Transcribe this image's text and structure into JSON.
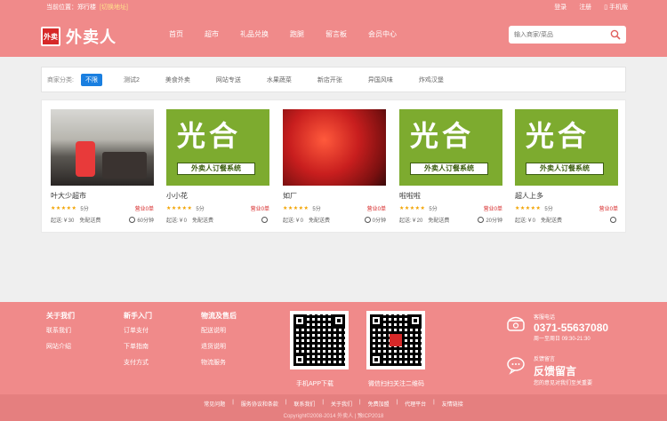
{
  "header": {
    "location_label": "当前位置：",
    "location_value": "郑行楼",
    "switch_label": "[切换地址]",
    "login": "登录",
    "register": "注册",
    "mobile": "手机版",
    "logo_badge": "外卖",
    "logo_text": "外卖人",
    "nav": [
      "首页",
      "超市",
      "礼品兑换",
      "跑腿",
      "留言板",
      "会员中心"
    ],
    "search_placeholder": "输入商家/菜品"
  },
  "filter": {
    "label": "商家分类:",
    "chips": [
      "不限",
      "测试2",
      "美食外卖",
      "网站专送",
      "水果蔬菜",
      "新店开张",
      "异国风味",
      "炸鸡汉堡"
    ],
    "active": "不限"
  },
  "shops": [
    {
      "name": "叶大少超市",
      "stars": "★★★★★",
      "score": "5分",
      "status": "营业0单",
      "min_order": "起送:￥30",
      "fee": "免配送费",
      "time": "60分钟",
      "image": "photo-delivery"
    },
    {
      "name": "小小花",
      "stars": "★★★★★",
      "score": "5分",
      "status": "营业0单",
      "min_order": "起送:￥0",
      "fee": "免配送费",
      "time": "",
      "image": "green-logo"
    },
    {
      "name": "如厂",
      "stars": "★★★★★",
      "score": "5分",
      "status": "营业0单",
      "min_order": "起送:￥0",
      "fee": "免配送费",
      "time": "0分钟",
      "image": "photo-leaves"
    },
    {
      "name": "啦啦啦",
      "stars": "★★★★★",
      "score": "5分",
      "status": "营业0单",
      "min_order": "起送:￥20",
      "fee": "免配送费",
      "time": "20分钟",
      "image": "green-logo"
    },
    {
      "name": "超人上多",
      "stars": "★★★★★",
      "score": "5分",
      "status": "营业0单",
      "min_order": "起送:￥0",
      "fee": "免配送费",
      "time": "",
      "image": "green-logo"
    }
  ],
  "logo_card": {
    "big": "光合",
    "bar": "外卖人订餐系统"
  },
  "footer": {
    "col1": {
      "title": "关于我们",
      "links": [
        "联系我们",
        "网站介绍"
      ]
    },
    "col2": {
      "title": "新手入门",
      "links": [
        "订单支付",
        "下单指南",
        "支付方式"
      ]
    },
    "col3": {
      "title": "物流及售后",
      "links": [
        "配送说明",
        "退货说明",
        "物流服务"
      ]
    },
    "qr1_caption": "手机APP下载",
    "qr2_caption": "微信扫扫关注二维码",
    "phone_label": "客服电话",
    "phone": "0371-55637080",
    "hours": "周一至周日 09:30-21:30",
    "feedback_label": "反馈留言",
    "feedback_title": "反馈留言",
    "feedback_sub": "您的意见对我们至关重要",
    "bottom_links": [
      "常见问题",
      "服务协议和条款",
      "联系我们",
      "关于我们",
      "免费加盟",
      "代理平台",
      "友情链接"
    ],
    "copyright": "Copyright©2008-2014 外卖人 | 豫ICP2018"
  }
}
